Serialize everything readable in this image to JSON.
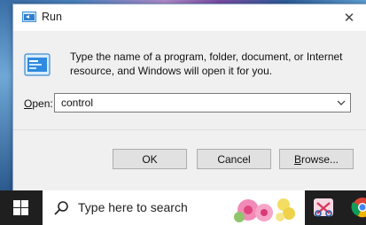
{
  "dialog": {
    "title": "Run",
    "description": "Type the name of a program, folder, document, or Internet resource, and Windows will open it for you.",
    "open_label_prefix": "O",
    "open_label_rest": "pen:",
    "open_value": "control",
    "ok_label": "OK",
    "cancel_label": "Cancel",
    "browse_label_prefix": "B",
    "browse_label_rest": "rowse..."
  },
  "taskbar": {
    "search_placeholder": "Type here to search"
  },
  "colors": {
    "taskbar": "#1f1f1f",
    "dialog_bg": "#f0f0f0",
    "button_bg": "#e1e1e1"
  }
}
